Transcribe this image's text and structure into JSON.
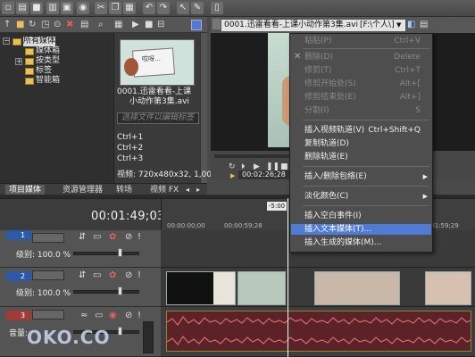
{
  "explorer": {
    "tree": [
      {
        "label": "所有媒体",
        "selected": true
      },
      {
        "label": "媒体箱"
      },
      {
        "label": "按类型"
      },
      {
        "label": "标签"
      },
      {
        "label": "智能箱"
      }
    ],
    "media_item": {
      "name_line1": "0001.迅雷看看-上课",
      "name_line2": "小动作第3集.avi",
      "tag_placeholder": "选择文件以编辑标签",
      "shortcuts": [
        "Ctrl+1",
        "Ctrl+2",
        "Ctrl+3"
      ],
      "video_info": "视频: 720x480x32, 1,000..."
    },
    "thumb_caption": "哎呀…"
  },
  "bottom_tabs": [
    "项目媒体",
    "资源管理器",
    "转场",
    "视频 FX"
  ],
  "preview": {
    "file_name": "0001.迅雷看看-上课小动作第3集.avi",
    "path": "[F:\\个人\\]",
    "timecode": "00:02:26;28"
  },
  "timeline": {
    "timecode": "00:01:49;03",
    "ruler_marks": [
      "00:00:00;00",
      "00:00:59;28",
      "00:01:59;29"
    ],
    "cursor_label": "-5:00"
  },
  "tracks": [
    {
      "number": "1",
      "level_label": "级别:",
      "level_value": "100.0 %",
      "type": "video"
    },
    {
      "number": "2",
      "level_label": "级别:",
      "level_value": "100.0 %",
      "type": "video"
    },
    {
      "number": "3",
      "vol_label": "音量:",
      "type": "audio"
    }
  ],
  "context_menu": {
    "items": [
      {
        "label": "粘贴(P)",
        "shortcut": "Ctrl+V",
        "disabled": true
      },
      {
        "label": "删除(D)",
        "shortcut": "Delete",
        "disabled": true
      },
      {
        "label": "修剪(T)",
        "shortcut": "Ctrl+T",
        "disabled": true
      },
      {
        "label": "修剪开始处(S)",
        "shortcut": "Alt+[",
        "disabled": true
      },
      {
        "label": "修剪结束处(E)",
        "shortcut": "Alt+]",
        "disabled": true
      },
      {
        "label": "分割(I)",
        "shortcut": "S",
        "disabled": true
      },
      {
        "label": "插入视频轨道(V)",
        "shortcut": "Ctrl+Shift+Q"
      },
      {
        "label": "复制轨道(D)"
      },
      {
        "label": "删除轨道(E)"
      },
      {
        "label": "插入/删除包络(E)",
        "submenu": true
      },
      {
        "label": "淡化颜色(C)",
        "submenu": true
      },
      {
        "label": "插入空白事件(I)"
      },
      {
        "label": "插入文本媒体(T)...",
        "highlighted": true
      },
      {
        "label": "插入生成的媒体(M)..."
      }
    ]
  },
  "watermark": "OKO.CO"
}
